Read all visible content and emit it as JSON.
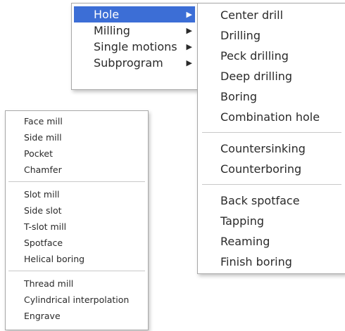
{
  "main_menu": {
    "items": [
      {
        "label": "Hole",
        "active": true
      },
      {
        "label": "Milling"
      },
      {
        "label": "Single motions"
      },
      {
        "label": "Subprogram"
      }
    ],
    "submenu_arrow_icon": "triangle-right-icon",
    "highlight_color": "#3c6ed6"
  },
  "hole_menu": {
    "group1": [
      "Center drill",
      "Drilling",
      "Peck drilling",
      "Deep drilling",
      "Boring",
      "Combination hole"
    ],
    "group2": [
      "Countersinking",
      "Counterboring"
    ],
    "group3": [
      "Back spotface",
      "Tapping",
      "Reaming",
      "Finish boring"
    ]
  },
  "milling_menu": {
    "group1": [
      "Face mill",
      "Side mill",
      "Pocket",
      "Chamfer"
    ],
    "group2": [
      "Slot mill",
      "Side slot",
      "T-slot mill",
      "Spotface",
      "Helical boring"
    ],
    "group3": [
      "Thread mill",
      "Cylindrical interpolation",
      "Engrave"
    ]
  }
}
